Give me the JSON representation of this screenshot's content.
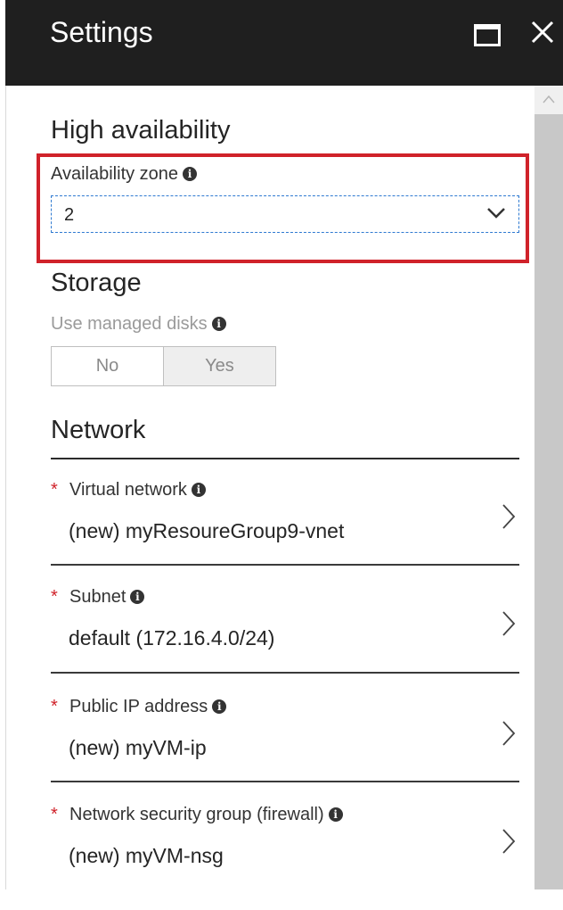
{
  "header": {
    "title": "Settings"
  },
  "high_availability": {
    "heading": "High availability",
    "zone_label": "Availability zone",
    "zone_value": "2"
  },
  "storage": {
    "heading": "Storage",
    "managed_disks_label": "Use managed disks",
    "options": [
      "No",
      "Yes"
    ],
    "selected": "Yes"
  },
  "network": {
    "heading": "Network",
    "rows": [
      {
        "required": "*",
        "label": "Virtual network",
        "value": "(new) myResoureGroup9-vnet"
      },
      {
        "required": "*",
        "label": "Subnet",
        "value": "default (172.16.4.0/24)"
      },
      {
        "required": "*",
        "label": "Public IP address",
        "value": "(new) myVM-ip"
      },
      {
        "required": "*",
        "label": "Network security group (firewall)",
        "value": "(new) myVM-nsg"
      }
    ]
  },
  "colors": {
    "header_bg": "#1f1f1f",
    "highlight": "#d0222a",
    "required": "#d0222a"
  }
}
